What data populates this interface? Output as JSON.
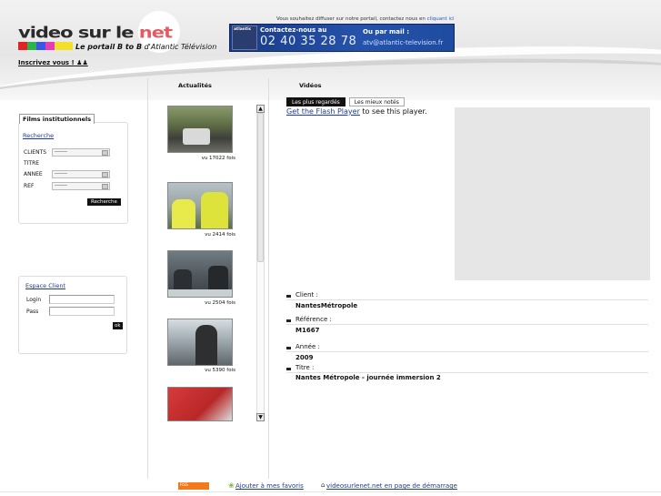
{
  "header": {
    "logo_main": "video sur le ",
    "logo_accent": "net",
    "tagline_bold": "Le portail B to B",
    "tagline_rest": " d'Atlantic Télévision",
    "signup": "Inscrivez vous !",
    "diffuse_text": "Vous souhaitez diffuser sur notre portail, contactez nous en ",
    "diffuse_link": "cliquant ici",
    "colorbar": [
      "#e02424",
      "#2ab44a",
      "#3b55e6",
      "#e63bb5",
      "#f3e02a",
      "#f3e02a"
    ]
  },
  "banner": {
    "logo": "atlantic",
    "contact_label": "Contactez-nous au",
    "phone": "02 40 35 28 78",
    "mail_label": "Ou par mail :",
    "mail": "atv@atlantic-television.fr"
  },
  "columns": {
    "news": "Actualités",
    "videos": "Vidéos"
  },
  "tabs": {
    "most_viewed": "Les plus regardés",
    "best_rated": "Les mieux notés"
  },
  "left_panel": {
    "tab": "Films institutionnels",
    "search_link": "Recherche",
    "fields": [
      {
        "label": "CLIENTS",
        "value": "-------"
      },
      {
        "label": "TITRE",
        "value": ""
      },
      {
        "label": "ANNEE",
        "value": "-------"
      },
      {
        "label": "REF",
        "value": "-------"
      }
    ],
    "search_button": "Recherche"
  },
  "client_panel": {
    "link": "Espace Client",
    "login_label": "Login",
    "pass_label": "Pass",
    "ok": "ok"
  },
  "thumbnails": [
    {
      "views": "vu 17022 fois"
    },
    {
      "views": "vu 2414 fois"
    },
    {
      "views": "vu 2504 fois"
    },
    {
      "views": "vu 5390 fois"
    },
    {
      "views": ""
    }
  ],
  "player": {
    "flash_link": "Get the Flash Player",
    "flash_rest": " to see this player."
  },
  "details": {
    "client_label": "Client :",
    "client": "NantesMétropole",
    "ref_label": "Référence :",
    "ref": "M1667",
    "year_label": "Année :",
    "year": "2009",
    "title_label": "Titre :",
    "title": "Nantes Métropole - journée immersion 2"
  },
  "footer": {
    "rss": "RSS",
    "favorites": "Ajouter à mes favoris",
    "homepage": "videosurlenet.net en page de démarrage"
  }
}
